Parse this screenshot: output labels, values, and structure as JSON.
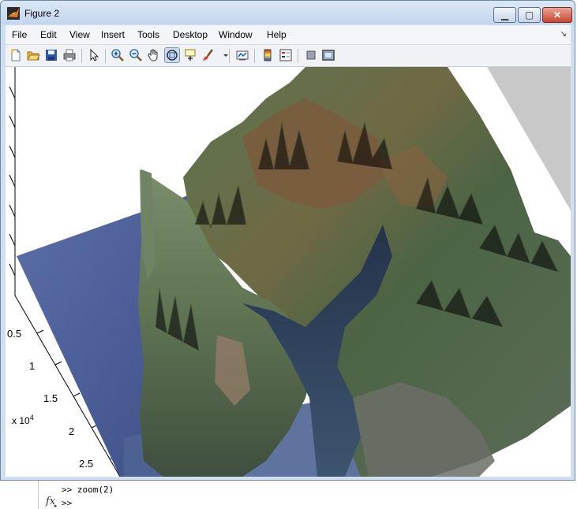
{
  "window": {
    "title": "Figure 2"
  },
  "menu": {
    "items": [
      "File",
      "Edit",
      "View",
      "Insert",
      "Tools",
      "Desktop",
      "Window",
      "Help"
    ]
  },
  "toolbar": {
    "buttons": [
      "new-figure",
      "open-file",
      "save-figure",
      "print-figure",
      "edit-plot",
      "zoom-in",
      "zoom-out",
      "pan",
      "rotate-3d",
      "data-cursor",
      "brush",
      "link-plot",
      "insert-colorbar",
      "insert-legend",
      "hide-plot-tools",
      "show-plot-tools"
    ],
    "pressed": "rotate-3d"
  },
  "axes": {
    "y_tick_labels": [
      "0.5",
      "1",
      "1.5",
      "2",
      "2.5"
    ],
    "exponent_base": "x 10",
    "exponent_power": "4"
  },
  "command_window": {
    "history_line": ">> zoom(2)",
    "prompt": ">>",
    "fx_symbol": "fx"
  },
  "colors": {
    "titlebar": "#c3d6ee",
    "water": "#4a5f9a",
    "terrain_green": "#4f6a45",
    "terrain_brown": "#8b5a3a",
    "grey_plane": "#c8c8c8"
  }
}
